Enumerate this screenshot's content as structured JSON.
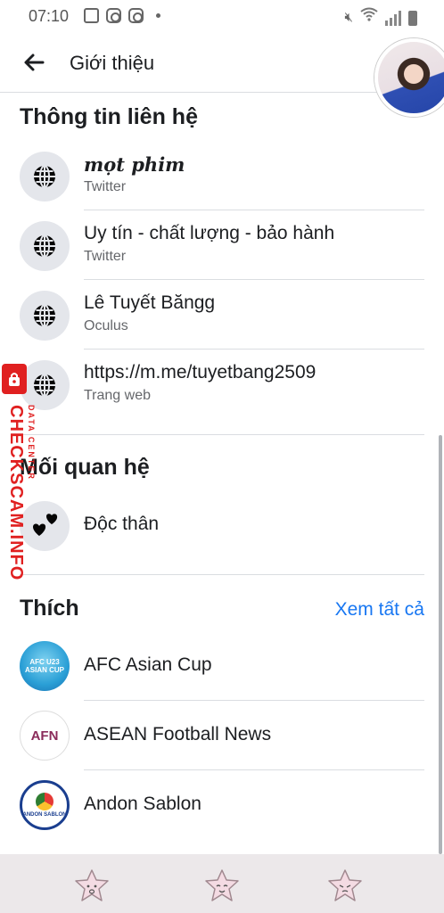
{
  "status_bar": {
    "time": "07:10",
    "left_icons": [
      "image-icon",
      "instagram-icon",
      "instagram-icon",
      "dot-icon"
    ],
    "right_icons": [
      "mute-icon",
      "wifi-icon",
      "signal-icon",
      "battery-icon"
    ]
  },
  "header": {
    "title": "Giới thiệu",
    "back_icon": "arrow-left-icon"
  },
  "contact": {
    "title": "Thông tin liên hệ",
    "items": [
      {
        "primary": "𝒎ọ𝒕 𝒑𝒉𝒊𝒎",
        "secondary": "Twitter",
        "icon": "globe-icon"
      },
      {
        "primary": "Uy tín - chất lượng - bảo hành",
        "secondary": "Twitter",
        "icon": "globe-icon"
      },
      {
        "primary": "Lê Tuyết Băngg",
        "secondary": "Oculus",
        "icon": "globe-icon"
      },
      {
        "primary": "https://m.me/tuyetbang2509",
        "secondary": "Trang web",
        "icon": "globe-icon"
      }
    ]
  },
  "relationship": {
    "title": "Mối quan hệ",
    "status": "Độc thân",
    "icon": "hearts-icon"
  },
  "likes": {
    "title": "Thích",
    "see_all": "Xem tất cả",
    "items": [
      {
        "name": "AFC Asian Cup",
        "logo_text": "AFC U23 ASIAN CUP"
      },
      {
        "name": "ASEAN Football News",
        "logo_text": "AFN"
      },
      {
        "name": "Andon Sablon",
        "logo_text": "ANDON SABLON"
      }
    ]
  },
  "watermark": {
    "text": "CHECKSCAM.INFO",
    "subtext": "DATA CENTER"
  },
  "bottom_nav": {
    "items": [
      "flower-face-icon",
      "flower-face-icon",
      "flower-face-icon"
    ]
  },
  "colors": {
    "accent": "#1877f2",
    "watermark": "#e02020",
    "icon_bg": "#e4e6eb",
    "nav_bg": "#ece8ea"
  }
}
